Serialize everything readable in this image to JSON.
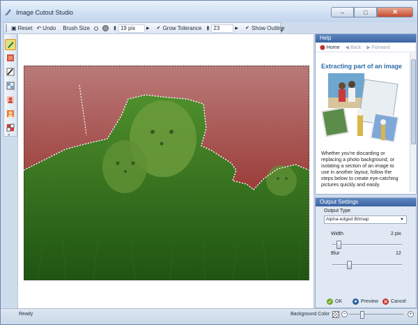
{
  "window": {
    "title": "Image Cutout Studio"
  },
  "toolbar": {
    "reset": "Reset",
    "undo": "Undo",
    "brush_size_label": "Brush Size",
    "brush_size_value": "19 pix",
    "grow_tolerance_label": "Grow Tolerance",
    "grow_tolerance_value": "23",
    "show_outline_label": "Show Outline",
    "show_outline_checked": true,
    "grow_tolerance_checked": true
  },
  "help": {
    "header": "Help",
    "nav": {
      "home": "Home",
      "back": "Back",
      "forward": "Forward"
    },
    "title": "Extracting part of an image",
    "body": "Whether you're discarding or replacing a photo background, or isolating a section of an image to use in another layout, follow the steps below to create eye-catching pictures quickly and easily."
  },
  "output": {
    "header": "Output Settings",
    "type_label": "Output Type",
    "type_value": "Alpha-edged Bitmap",
    "width_label": "Width",
    "width_value": "2 pix",
    "blur_label": "Blur",
    "blur_value": "12",
    "ok": "OK",
    "preview": "Preview",
    "cancel": "Cancel"
  },
  "status": {
    "text": "Ready",
    "background_color_label": "Background Color"
  }
}
